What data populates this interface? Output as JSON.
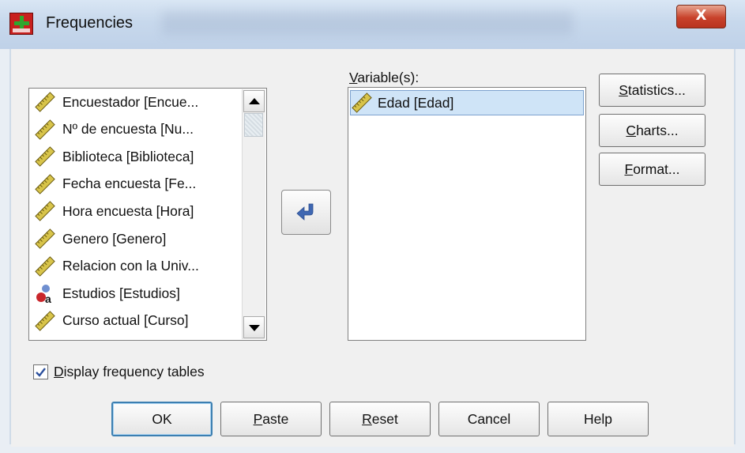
{
  "window": {
    "title": "Frequencies",
    "close_glyph": "X"
  },
  "source_list": {
    "items": [
      {
        "label": "Encuestador [Encue...",
        "icon": "scale-ruler-icon"
      },
      {
        "label": "Nº de encuesta [Nu...",
        "icon": "scale-ruler-icon"
      },
      {
        "label": "Biblioteca [Biblioteca]",
        "icon": "scale-ruler-icon"
      },
      {
        "label": "Fecha encuesta [Fe...",
        "icon": "scale-ruler-icon"
      },
      {
        "label": "Hora encuesta [Hora]",
        "icon": "scale-ruler-icon"
      },
      {
        "label": "Genero [Genero]",
        "icon": "scale-ruler-icon"
      },
      {
        "label": "Relacion con la Univ...",
        "icon": "scale-ruler-icon"
      },
      {
        "label": "Estudios [Estudios]",
        "icon": "nominal-string-icon"
      },
      {
        "label": "Curso actual [Curso]",
        "icon": "scale-ruler-icon"
      }
    ]
  },
  "target": {
    "label_prefix": "V",
    "label_rest": "ariable(s):",
    "items": [
      {
        "label": "Edad [Edad]",
        "icon": "scale-ruler-icon"
      }
    ]
  },
  "side_buttons": {
    "statistics": {
      "u": "S",
      "rest": "tatistics..."
    },
    "charts": {
      "u": "C",
      "rest": "harts..."
    },
    "format": {
      "u": "F",
      "rest": "ormat..."
    }
  },
  "display_tables": {
    "checked": true,
    "u": "D",
    "rest": "isplay frequency tables"
  },
  "bottom_buttons": {
    "ok": "OK",
    "paste": {
      "u": "P",
      "rest": "aste"
    },
    "reset": {
      "u": "R",
      "rest": "eset"
    },
    "cancel": "Cancel",
    "help": "Help"
  },
  "colors": {
    "selection": "#cfe4f7",
    "move_arrow": "#3f67b2",
    "ruler": "#c8b33a"
  }
}
